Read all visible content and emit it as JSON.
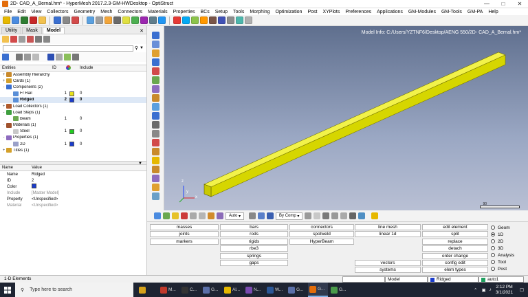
{
  "window": {
    "title": "2D- CAD_A_Bernal.hm* - HyperMesh 2017.2.3-GM-HWDesktop - OptiStruct",
    "minimize_icon": "minimize-icon",
    "maximize_icon": "maximize-icon",
    "close_icon": "close-icon"
  },
  "menu": [
    "File",
    "Edit",
    "View",
    "Collectors",
    "Geometry",
    "Mesh",
    "Connectors",
    "Materials",
    "Properties",
    "BCs",
    "Setup",
    "Tools",
    "Morphing",
    "Optimization",
    "Post",
    "XYPlots",
    "Preferences",
    "Applications",
    "GM-Modules",
    "GM-Tools",
    "GM-PA",
    "Help"
  ],
  "browser": {
    "tabs": [
      "Utility",
      "Mask",
      "Model"
    ],
    "active_tab": "Model",
    "columns": {
      "entities": "Entities",
      "id": "ID",
      "include": "Include"
    },
    "tree": [
      {
        "level": 0,
        "expand": "+",
        "icon": "assembly-icon",
        "name": "Assembly Hierarchy",
        "id": "",
        "color": "",
        "include": ""
      },
      {
        "level": 0,
        "expand": "+",
        "icon": "cards-icon",
        "name": "Cards (1)",
        "id": "",
        "color": "",
        "include": ""
      },
      {
        "level": 0,
        "expand": "-",
        "icon": "components-icon",
        "name": "Components (2)",
        "id": "",
        "color": "",
        "include": ""
      },
      {
        "level": 1,
        "expand": "",
        "icon": "component-icon",
        "name": "Fr Rail",
        "id": "1",
        "color": "#e8e21a",
        "include": "0"
      },
      {
        "level": 1,
        "expand": "",
        "icon": "component-icon",
        "name": "Ridged",
        "id": "2",
        "color": "#1a3ccc",
        "include": "0",
        "selected": true
      },
      {
        "level": 0,
        "expand": "+",
        "icon": "load-collectors-icon",
        "name": "Load Collectors (1)",
        "id": "",
        "color": "",
        "include": ""
      },
      {
        "level": 0,
        "expand": "-",
        "icon": "load-steps-icon",
        "name": "Load Steps (1)",
        "id": "",
        "color": "",
        "include": ""
      },
      {
        "level": 1,
        "expand": "",
        "icon": "loadstep-icon",
        "name": "Beam",
        "id": "1",
        "color": "",
        "include": "0"
      },
      {
        "level": 0,
        "expand": "-",
        "icon": "materials-icon",
        "name": "Materials (1)",
        "id": "",
        "color": "",
        "include": ""
      },
      {
        "level": 1,
        "expand": "",
        "icon": "material-icon",
        "name": "Steel",
        "id": "1",
        "color": "#22cc22",
        "include": "0"
      },
      {
        "level": 0,
        "expand": "-",
        "icon": "properties-icon",
        "name": "Properties (1)",
        "id": "",
        "color": "",
        "include": ""
      },
      {
        "level": 1,
        "expand": "",
        "icon": "property-icon",
        "name": "2D",
        "id": "1",
        "color": "#1a3ccc",
        "include": "0"
      },
      {
        "level": 0,
        "expand": "+",
        "icon": "titles-icon",
        "name": "Titles (1)",
        "id": "",
        "color": "",
        "include": ""
      }
    ]
  },
  "properties": {
    "headers": {
      "name": "Name",
      "value": "Value"
    },
    "rows": [
      {
        "name": "Name",
        "value": "Ridged",
        "grey": false
      },
      {
        "name": "ID",
        "value": "2",
        "grey": false
      },
      {
        "name": "Color",
        "value": "",
        "swatch": "#1a3ccc",
        "grey": false
      },
      {
        "name": "Include",
        "value": "[Master Model]",
        "grey": true
      },
      {
        "name": "Property",
        "value": "<Unspecified>",
        "grey": false
      },
      {
        "name": "Material",
        "value": "<Unspecified>",
        "grey": true
      }
    ]
  },
  "viewport": {
    "model_info": "Model Info: C:/Users/YZTNF6/Desktop/AENG 550/2D- CAD_A_Bernal.hm*",
    "beam_color": "#e6e600",
    "axes": {
      "x": "x",
      "y": "y",
      "z": "z"
    },
    "scale_label": "90"
  },
  "bottom_toolbar": {
    "auto_label": "Auto",
    "bycomp_label": "By Comp"
  },
  "panel": {
    "buttons": [
      {
        "label": "masses",
        "col": 0,
        "row": 0
      },
      {
        "label": "joints",
        "col": 0,
        "row": 1
      },
      {
        "label": "markers",
        "col": 0,
        "row": 2
      },
      {
        "label": "bars",
        "col": 1,
        "row": 0
      },
      {
        "label": "rods",
        "col": 1,
        "row": 1
      },
      {
        "label": "rigids",
        "col": 1,
        "row": 2
      },
      {
        "label": "rbe3",
        "col": 1,
        "row": 3
      },
      {
        "label": "springs",
        "col": 1,
        "row": 4
      },
      {
        "label": "gaps",
        "col": 1,
        "row": 5
      },
      {
        "label": "connectors",
        "col": 2,
        "row": 0
      },
      {
        "label": "spotweld",
        "col": 2,
        "row": 1
      },
      {
        "label": "HyperBeam",
        "col": 2,
        "row": 2
      },
      {
        "label": "line mesh",
        "col": 3,
        "row": 0
      },
      {
        "label": "linear 1d",
        "col": 3,
        "row": 1
      },
      {
        "label": "vectors",
        "col": 3,
        "row": 5
      },
      {
        "label": "systems",
        "col": 3,
        "row": 6
      },
      {
        "label": "edit element",
        "col": 4,
        "row": 0
      },
      {
        "label": "split",
        "col": 4,
        "row": 1
      },
      {
        "label": "replace",
        "col": 4,
        "row": 2
      },
      {
        "label": "detach",
        "col": 4,
        "row": 3
      },
      {
        "label": "order change",
        "col": 4,
        "row": 4
      },
      {
        "label": "config edit",
        "col": 4,
        "row": 5
      },
      {
        "label": "elem types",
        "col": 4,
        "row": 6
      }
    ],
    "radios": [
      {
        "label": "Geom",
        "on": false
      },
      {
        "label": "1D",
        "on": true
      },
      {
        "label": "2D",
        "on": false
      },
      {
        "label": "3D",
        "on": false
      },
      {
        "label": "Analysis",
        "on": false
      },
      {
        "label": "Tool",
        "on": false
      },
      {
        "label": "Post",
        "on": false
      }
    ]
  },
  "status": {
    "left": "1-D Elements",
    "model": "Model",
    "component": "Ridged",
    "component_color": "#1a3ccc",
    "loadcol": "auto1",
    "loadcol_color": "#20a060"
  },
  "taskbar": {
    "search_placeholder": "Type here to search",
    "apps": [
      {
        "label": "",
        "color": "#d6a21b",
        "active": false
      },
      {
        "label": "M...",
        "color": "#c0392b",
        "active": false
      },
      {
        "label": "C...",
        "color": "#333333",
        "active": false
      },
      {
        "label": "G...",
        "color": "#5a6fa8",
        "active": false
      },
      {
        "label": "Al...",
        "color": "#e6b800",
        "active": false
      },
      {
        "label": "N...",
        "color": "#7a4ab0",
        "active": false
      },
      {
        "label": "W...",
        "color": "#2b5797",
        "active": false
      },
      {
        "label": "G...",
        "color": "#5a6fa8",
        "active": false
      },
      {
        "label": "G...",
        "color": "#e36c09",
        "active": true
      },
      {
        "label": "G...",
        "color": "#4a9a4a",
        "active": false
      }
    ],
    "time": "2:12 PM",
    "date": "3/1/2021"
  }
}
